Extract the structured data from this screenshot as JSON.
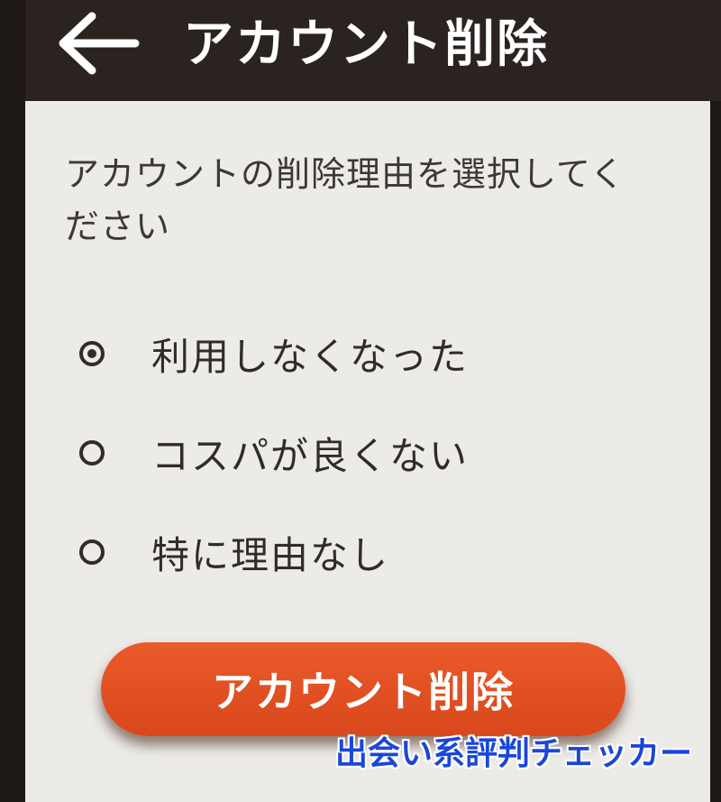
{
  "header": {
    "back_icon": "arrow-left-icon",
    "title": "アカウント削除"
  },
  "instruction": "アカウントの削除理由を選択してください",
  "reasons": [
    {
      "label": "利用しなくなった",
      "selected": true
    },
    {
      "label": "コスパが良くない",
      "selected": false
    },
    {
      "label": "特に理由なし",
      "selected": false
    }
  ],
  "delete_button": {
    "label": "アカウント削除",
    "color": "#e4522a"
  },
  "watermark": "出会い系評判チェッカー",
  "colors": {
    "header_bg": "#2b2320",
    "content_bg": "#ecebe8",
    "accent": "#e4522a",
    "watermark": "#1a47d8"
  }
}
